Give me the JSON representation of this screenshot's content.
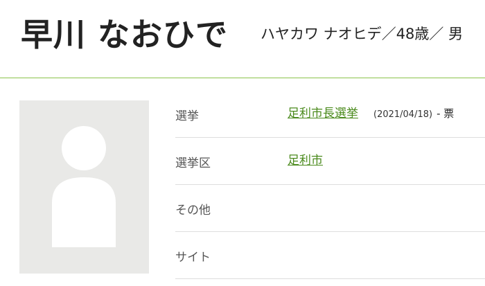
{
  "profile": {
    "name": "早川 なおひで",
    "kana": "ハヤカワ ナオヒデ",
    "age": "48歳",
    "sex": "男",
    "separator": "／"
  },
  "info": {
    "rows": [
      {
        "label": "選挙",
        "link": "足利市長選挙",
        "date": "(2021/04/18)",
        "votes": "- 票"
      },
      {
        "label": "選挙区",
        "link": "足利市"
      },
      {
        "label": "その他"
      },
      {
        "label": "サイト"
      }
    ]
  },
  "colors": {
    "accent": "#4a8a1c",
    "divider": "#8bc34a",
    "photo_bg": "#e9e9e7"
  }
}
